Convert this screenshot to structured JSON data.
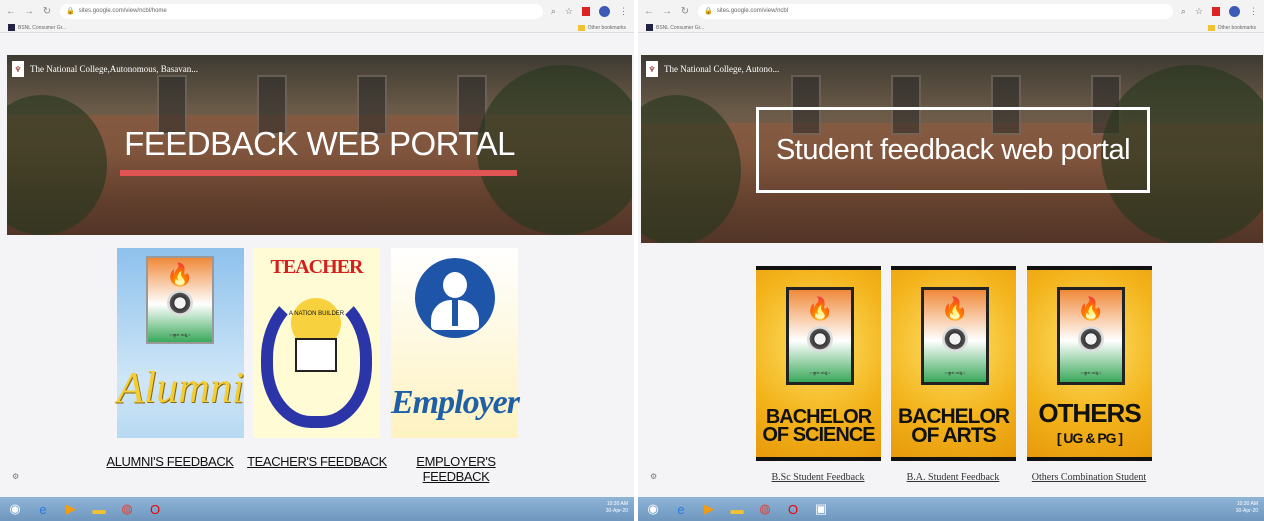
{
  "left": {
    "url": "sites.google.com/view/ncbl/home",
    "bookmark": "BSNL Consumer Gr...",
    "other_bookmarks": "Other bookmarks",
    "site_name": "The National College,Autonomous, Basavan...",
    "banner_title": "FEEDBACK WEB PORTAL",
    "cards": [
      {
        "image_text": "Alumni",
        "label": "ALUMNI'S FEEDBACK"
      },
      {
        "image_text": "TEACHER",
        "sub": "A NATION BUILDER",
        "label": "TEACHER'S FEEDBACK"
      },
      {
        "image_text": "Employer",
        "label": "EMPLOYER'S FEEDBACK"
      }
    ]
  },
  "right": {
    "url": "sites.google.com/view/ncbl",
    "bookmark": "BSNL Consumer Gr...",
    "other_bookmarks": "Other bookmarks",
    "site_name": "The National College, Autono...",
    "banner_title": "Student feedback web portal",
    "cards": [
      {
        "image_text": "BACHELOR OF SCIENCE",
        "label": "B.Sc Student Feedback"
      },
      {
        "image_text": "BACHELOR OF ARTS",
        "label": "B.A. Student Feedback"
      },
      {
        "image_text": "OTHERS",
        "sub": "[ UG & PG ]",
        "label": "Others Combination Student"
      }
    ]
  },
  "tray": {
    "time": "10:30 AM",
    "date": "30-Apr-20"
  },
  "colors": {
    "banner_underline": "#e05454",
    "taskbar": "#7aa2c8",
    "card_yellow": "#f3b21a"
  },
  "icons": [
    "back-icon",
    "forward-icon",
    "reload-icon",
    "lock-icon",
    "zoom-icon",
    "star-icon",
    "pdf-icon",
    "profile-icon",
    "menu-icon",
    "start-icon",
    "ie-icon",
    "media-icon",
    "folder-icon",
    "chrome-icon",
    "opera-icon"
  ]
}
